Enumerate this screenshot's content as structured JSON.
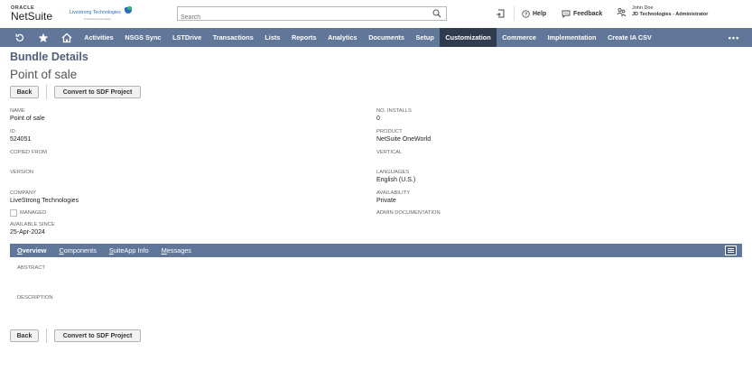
{
  "header": {
    "oracle_text": "ORACLE",
    "netsuite_text": "NetSuite",
    "company_logo_text": "Livestrong Technologies",
    "company_logo_subtext": "Transforming Innovation",
    "search_placeholder": "Search",
    "help_label": "Help",
    "feedback_label": "Feedback",
    "user_name": "John Doe",
    "user_role": "JD Technologies - Administrator"
  },
  "nav": {
    "items": [
      "Activities",
      "NSGS Sync",
      "LSTDrive",
      "Transactions",
      "Lists",
      "Reports",
      "Analytics",
      "Documents",
      "Setup",
      "Customization",
      "Commerce",
      "Implementation",
      "Create IA CSV"
    ],
    "active": "Customization",
    "more": "•••"
  },
  "page": {
    "title": "Bundle Details",
    "record_name": "Point of sale",
    "back_label": "Back",
    "convert_label": "Convert to SDF Project"
  },
  "fields_left": {
    "name_label": "NAME",
    "name_value": "Point of sale",
    "id_label": "ID",
    "id_value": "524051",
    "copied_from_label": "COPIED FROM",
    "version_label": "VERSION",
    "company_label": "COMPANY",
    "company_value": "LiveStrong Technologies",
    "managed_label": "MANAGED",
    "available_since_label": "AVAILABLE SINCE",
    "available_since_value": "25-Apr-2024"
  },
  "fields_right": {
    "installs_label": "NO. INSTALLS",
    "installs_value": "0",
    "product_label": "PRODUCT",
    "product_value": "NetSuite OneWorld",
    "vertical_label": "VERTICAL",
    "languages_label": "LANGUAGES",
    "languages_value": "English (U.S.)",
    "availability_label": "AVAILABILITY",
    "availability_value": "Private",
    "admin_doc_label": "ADMIN DOCUMENTATION"
  },
  "subtabs": {
    "overview": {
      "first": "O",
      "rest": "verview"
    },
    "components": {
      "first": "C",
      "rest": "omponents"
    },
    "suiteapp": {
      "first": "S",
      "rest": "uiteApp Info"
    },
    "messages": {
      "first": "M",
      "rest": "essages"
    },
    "active": "Overview"
  },
  "overview": {
    "abstract_label": "ABSTRACT",
    "description_label": "DESCRIPTION"
  },
  "colors": {
    "nav_bg": "#607799",
    "nav_active_bg": "#2f3c50",
    "title_color": "#4d5f79"
  }
}
